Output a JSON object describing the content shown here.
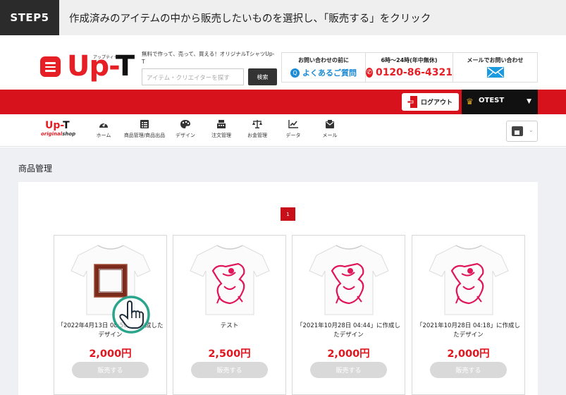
{
  "step": {
    "badge": "STEP5",
    "instruction": "作成済みのアイテムの中から販売したいものを選択し、「販売する」をクリック"
  },
  "header": {
    "logo_text_main": "Up-",
    "logo_text_t": "T",
    "logo_kana": "アップティー",
    "tagline": "無料で作って、売って、買える！オリジナルTシャツUp-T",
    "search": {
      "placeholder": "アイテム・クリエイターを探す",
      "button_label": "検索"
    },
    "faq": {
      "title": "お問い合わせの前に",
      "link": "よくあるご質問",
      "icon": "question-icon"
    },
    "phone": {
      "title": "6時〜24時(年中無休)",
      "number": "0120-86-4321",
      "icon": "phone-icon"
    },
    "mail": {
      "title": "メールでお問い合わせ",
      "icon": "mail-icon"
    }
  },
  "topbar": {
    "logout_label": "ログアウト",
    "user_name": "OTEST",
    "accent_color": "#d8121c"
  },
  "shop_nav": {
    "logo_main": "Up-",
    "logo_t": "T",
    "logo_sub_original": "original",
    "logo_sub_shop": "shop",
    "items": [
      {
        "label": "ホーム",
        "icon": "dashboard-icon"
      },
      {
        "label": "商品管理/商品出品",
        "icon": "list-icon"
      },
      {
        "label": "デザイン",
        "icon": "palette-icon"
      },
      {
        "label": "注文管理",
        "icon": "register-icon"
      },
      {
        "label": "お金管理",
        "icon": "scale-icon"
      },
      {
        "label": "データ",
        "icon": "chart-icon"
      },
      {
        "label": "メール",
        "icon": "mailbox-icon"
      }
    ]
  },
  "main": {
    "heading": "商品管理",
    "pagination": {
      "current": "1"
    },
    "products": [
      {
        "title": "「2022年4月13日 08:50」に作成したデザイン",
        "price": "2,000円",
        "sell_label": "販売する",
        "design": "frame"
      },
      {
        "title": "テスト",
        "price": "2,500円",
        "sell_label": "販売する",
        "design": "figure"
      },
      {
        "title": "「2021年10月28日 04:44」に作成したデザイン",
        "price": "2,000円",
        "sell_label": "販売する",
        "design": "figure"
      },
      {
        "title": "「2021年10月28日 04:18」に作成したデザイン",
        "price": "2,000円",
        "sell_label": "販売する",
        "design": "figure"
      }
    ]
  }
}
